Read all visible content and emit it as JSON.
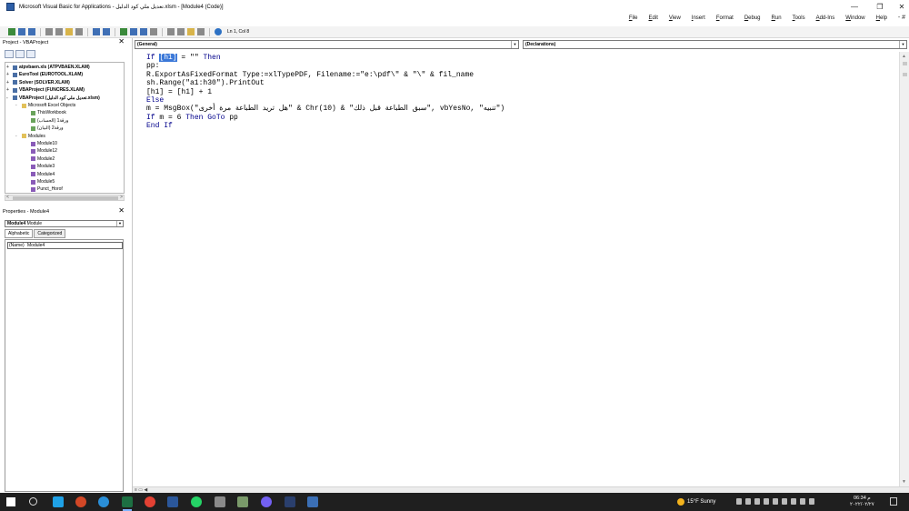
{
  "window": {
    "title": "Microsoft Visual Basic for Applications - تعديل ملي كود الدليل.xlsm - [Module4 (Code)]",
    "minimize": "—",
    "maximize": "❐",
    "close": "✕"
  },
  "menu": [
    "Help",
    "Window",
    "Add-Ins",
    "Tools",
    "Run",
    "Debug",
    "Format",
    "Insert",
    "View",
    "Edit",
    "File"
  ],
  "menu_extra": "- #",
  "toolbar": {
    "cursor_position": "Ln 1, Col 8"
  },
  "project_explorer": {
    "title": "Project - VBAProject",
    "items": [
      {
        "label": "atpvbaen.xls (ATPVBAEN.XLAM)",
        "bold": true,
        "type": "proj",
        "exp": "+"
      },
      {
        "label": "EuroTool (EUROTOOL.XLAM)",
        "bold": true,
        "type": "proj",
        "exp": "+"
      },
      {
        "label": "Solver (SOLVER.XLAM)",
        "bold": true,
        "type": "proj",
        "exp": "+"
      },
      {
        "label": "VBAProject (FUNCRES.XLAM)",
        "bold": true,
        "type": "proj",
        "exp": "+"
      },
      {
        "label": "VBAProject (تعديل ملي كود الدليل.xlsm)",
        "bold": true,
        "type": "proj",
        "exp": "-"
      },
      {
        "label": "Microsoft Excel Objects",
        "bold": false,
        "type": "folder",
        "exp": "-"
      },
      {
        "label": "ThisWorkbook",
        "bold": false,
        "type": "sheet",
        "exp": ""
      },
      {
        "label": "ورقة1 (الحساب)",
        "bold": false,
        "type": "sheet",
        "exp": ""
      },
      {
        "label": "ورقة2 (البيان)",
        "bold": false,
        "type": "sheet",
        "exp": ""
      },
      {
        "label": "Modules",
        "bold": false,
        "type": "folder",
        "exp": "-"
      },
      {
        "label": "Module10",
        "bold": false,
        "type": "module",
        "exp": ""
      },
      {
        "label": "Module12",
        "bold": false,
        "type": "module",
        "exp": ""
      },
      {
        "label": "Module2",
        "bold": false,
        "type": "module",
        "exp": ""
      },
      {
        "label": "Module3",
        "bold": false,
        "type": "module",
        "exp": ""
      },
      {
        "label": "Module4",
        "bold": false,
        "type": "module",
        "exp": ""
      },
      {
        "label": "Module5",
        "bold": false,
        "type": "module",
        "exp": ""
      },
      {
        "label": "Punct_Horof",
        "bold": false,
        "type": "module",
        "exp": ""
      }
    ],
    "scroll_left": "<",
    "scroll_right": ">"
  },
  "properties": {
    "title": "Properties - Module4",
    "object_name": "Module4",
    "object_type": "Module",
    "tabs": [
      "Alphabetic",
      "Categorized"
    ],
    "rows": [
      {
        "key": "(Name)",
        "value": "Module4"
      }
    ]
  },
  "code_window": {
    "object_combo": "(General)",
    "procedure_combo": "(Declarations)",
    "lines": [
      "If [h1] = \"\" Then",
      "pp:",
      "R.ExportAsFixedFormat Type:=xlTypePDF, Filename:=\"e:\\pdf\\\" & \"\\\" & fil_name",
      "sh.Range(\"a1:h30\").PrintOut",
      "[h1] = [h1] + 1",
      "Else",
      "m = MsgBox(\"هل تريد الطباعة مرة أخرى\" & Chr(10) & \"سبق الطباعة قبل ذلك\", vbYesNo, \"تنبيه\")",
      "If m = 6 Then GoTo pp",
      "End If"
    ]
  },
  "taskbar": {
    "weather": "15°F  Sunny",
    "time": "06:34 م",
    "date": "٢٠٢٢/٠٢/٢٧"
  }
}
